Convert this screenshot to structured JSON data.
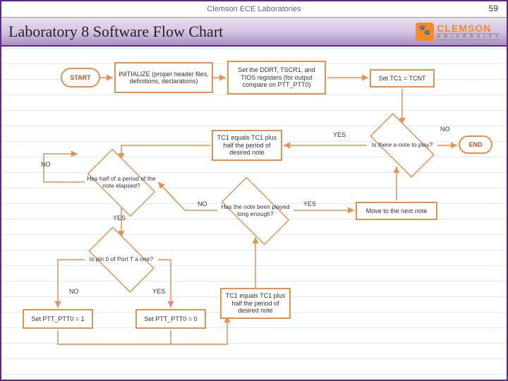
{
  "header": {
    "org": "Clemson ECE Laboratories",
    "page_number": "59",
    "title": "Laboratory 8 Software Flow Chart",
    "logo_main": "CLEMSON",
    "logo_sub": "U N I V E R S I T Y"
  },
  "flowchart": {
    "nodes": {
      "start": "START",
      "init": "INITIALIZE (proper header files, definitions, declarations)",
      "setreg": "Set the DDRT, TSCR1, and TIOS registers (for output compare on PTT_PTT0)",
      "settc1": "Set TC1 = TCNT",
      "noteq": "Is there a note to play?",
      "end": "END",
      "tc1half1": "TC1 equals TC1 plus half the period of desired note",
      "half": "Has half of a period of the note elapsed?",
      "longenough": "Has the note been played long enough?",
      "movenext": "Move to the next note",
      "pin0": "Is pin 0 of Port T a one?",
      "tc1half2": "TC1 equals TC1 plus half the period of desired note",
      "setptt1": "Set PTT_PTT0 = 1",
      "setptt0": "Set PTT_PTT0 = 0"
    },
    "labels": {
      "yes": "YES",
      "no": "NO"
    }
  }
}
